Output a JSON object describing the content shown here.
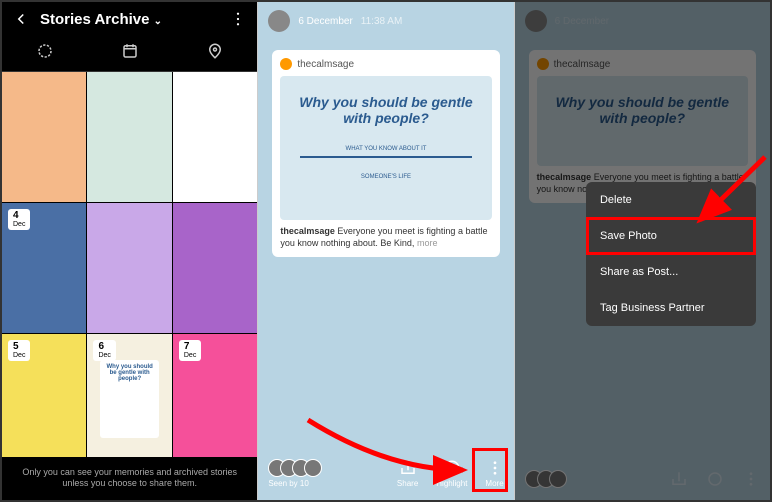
{
  "panel1": {
    "title": "Stories Archive",
    "footer": "Only you can see your memories and archived stories unless you choose to share them.",
    "dates": [
      {
        "day": "4",
        "month": "Dec"
      },
      {
        "day": "5",
        "month": "Dec"
      },
      {
        "day": "6",
        "month": "Dec"
      },
      {
        "day": "7",
        "month": "Dec"
      }
    ],
    "inner_card_text": "Why you should be gentle with people?"
  },
  "story": {
    "date": "6 December",
    "time": "11:38 AM",
    "card_user": "thecalmsage",
    "headline": "Why you should be gentle with people?",
    "sub1": "WHAT YOU KNOW ABOUT IT",
    "sub2": "SOMEONE'S LIFE",
    "caption_user": "thecalmsage",
    "caption_text": "Everyone you meet is fighting a battle you know nothing about. Be Kind,",
    "caption_more": "more",
    "seen_by": "Seen by 10",
    "action_share": "Share",
    "action_highlight": "Highlight",
    "action_more": "More"
  },
  "menu": {
    "delete": "Delete",
    "save": "Save Photo",
    "share_post": "Share as Post...",
    "tag_partner": "Tag Business Partner"
  }
}
